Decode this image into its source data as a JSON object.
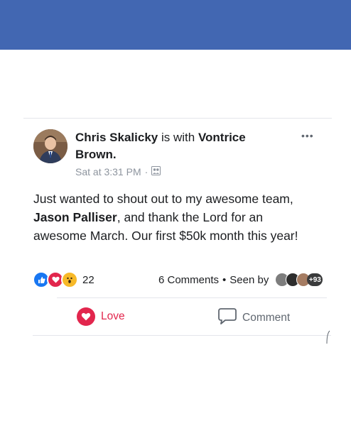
{
  "post": {
    "author": "Chris Skalicky",
    "with_text": "is with",
    "tagged": "Vontrice",
    "tagged_cont": "Brown.",
    "time": "Sat at 3:31 PM",
    "separator": "·",
    "body_part1": "Just wanted to shout out to my awesome team, ",
    "body_mention": "Jason Palliser",
    "body_part2": ", and thank the Lord for an awesome March. Our first $50k month this year!",
    "more_label": "•••"
  },
  "stats": {
    "reaction_count": "22",
    "comments": "6 Comments",
    "dot": "•",
    "seen_by": "Seen by",
    "seen_more": "+93"
  },
  "actions": {
    "love_label": "Love",
    "comment_label": "Comment"
  },
  "colors": {
    "topbar": "#4267b2",
    "love": "#e2264d",
    "like": "#1877f2",
    "wow": "#f7b928"
  },
  "icons": [
    "like-icon",
    "love-icon",
    "wow-icon",
    "audience-icon",
    "comment-icon",
    "more-icon"
  ]
}
